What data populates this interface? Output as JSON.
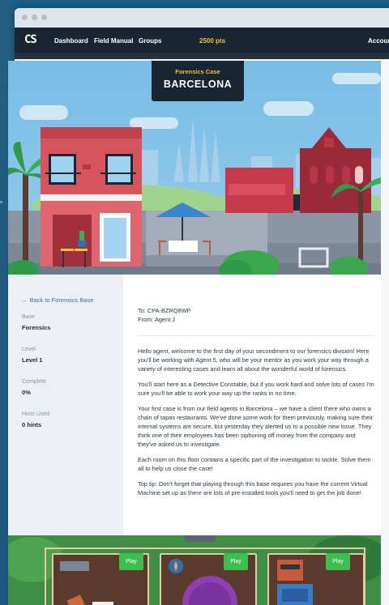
{
  "nav": {
    "logo": "CS",
    "items": [
      "Dashboard",
      "Field Manual",
      "Groups"
    ],
    "points": "2500 pts",
    "account": "Accoun"
  },
  "hero": {
    "kicker": "Forensics Case",
    "city": "BARCELONA"
  },
  "sidebar": {
    "back_link": "← Back to Forensics Base",
    "fields": [
      {
        "label": "Base",
        "value": "Forensics"
      },
      {
        "label": "Level",
        "value": "Level 1"
      },
      {
        "label": "Complete",
        "value": "0%"
      },
      {
        "label": "Hints Used",
        "value": "0 hints"
      }
    ]
  },
  "letter": {
    "to": "To: CPA-BZRQ8WP",
    "from": "From: Agent J",
    "paragraphs": [
      "Hello agent, welcome to the first day of your secondment to our forensics division! Here you'll be working with Agent 5, who will be your mentor as you work your way through a variety of interesting cases and learn all about the wonderful world of forensics.",
      "You'll start here as a Detective Constable, but if you work hard and solve lots of cases I'm sure you'll be able to work your way up the ranks in no time.",
      "Your first case is from our field agents in Barcelona – we have a client there who owns a chain of tapas restaurants. We've done some work for them previously, making sure their internal systems are secure, but yesterday they alerted us to a possible new issue. They think one of their employees has been siphoning off money from the company and they've asked us to investigate.",
      "Each room on this floor contains a specific part of the investigation to tackle. Solve them all to help us close the case!",
      "Top tip: Don't forget that playing through this base requires you have the current Virtual Machine set up as there are lots of pre-installed tools you'll need to get the job done!"
    ]
  },
  "rooms": {
    "play_label": "Play"
  },
  "colors": {
    "navbar": "#1a2533",
    "points": "#f2c230",
    "link": "#2f6fb3",
    "play": "#3bbf4f"
  }
}
